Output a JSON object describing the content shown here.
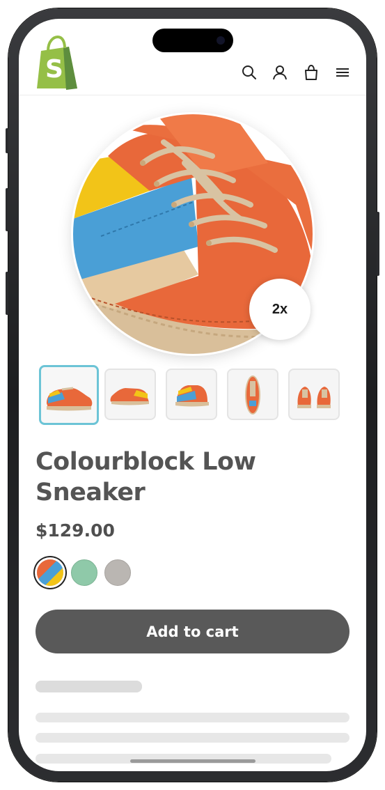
{
  "header": {
    "logo": "shopify-bag-logo",
    "icons": [
      "search-icon",
      "account-icon",
      "cart-bag-icon",
      "menu-icon"
    ]
  },
  "product": {
    "title": "Colourblock Low Sneaker",
    "price": "$129.00",
    "zoom_label": "2x",
    "thumbnails_count_text": "",
    "add_to_cart_label": "Add to cart"
  },
  "colors": {
    "accent_active_thumb": "#6cc4d6",
    "button_bg": "#595959",
    "shoe_orange": "#e8683a",
    "shoe_blue": "#4a9fd6",
    "shoe_yellow": "#f2c418",
    "swatch_green": "#8fc9a9",
    "swatch_grey": "#bab6b2"
  },
  "swatches": [
    "multicolour",
    "green",
    "grey"
  ]
}
